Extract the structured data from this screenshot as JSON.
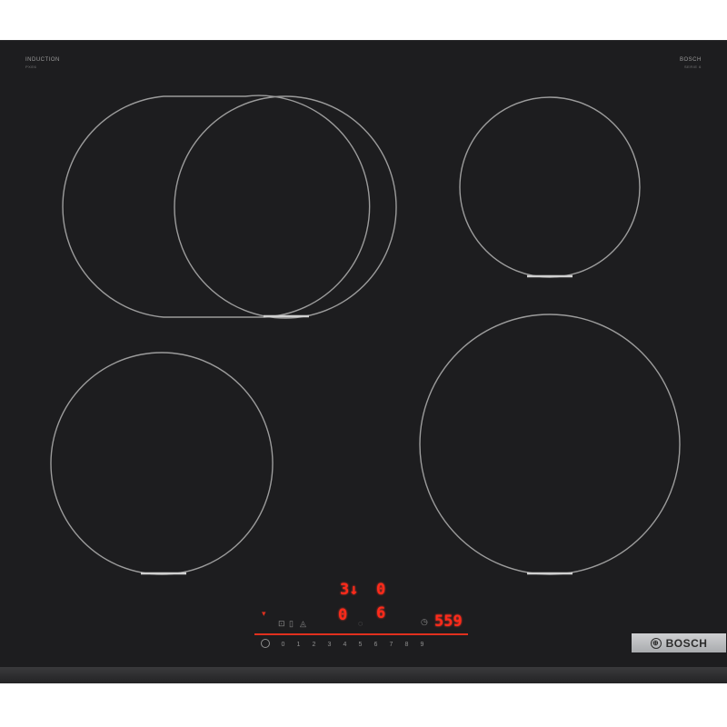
{
  "labels": {
    "top_left": "INDUCTION",
    "top_left_sub": "PXE6",
    "top_right": "BOSCH",
    "top_right_sub": "SERIE 6"
  },
  "display": {
    "zone_a_level": "3",
    "zone_a_suffix": "↓",
    "zone_b_level": "0",
    "zone_c_level": "0",
    "zone_d_level": "6",
    "timer": "559"
  },
  "scale": [
    "0",
    "1",
    "2",
    "3",
    "4",
    "5",
    "6",
    "7",
    "8",
    "9"
  ],
  "brand": {
    "name": "BOSCH",
    "logo_glyph": "⊕"
  },
  "colors": {
    "glass": "#1d1d1f",
    "display_red": "#ff2a1a",
    "zone_outline": "#9c9c9c"
  }
}
